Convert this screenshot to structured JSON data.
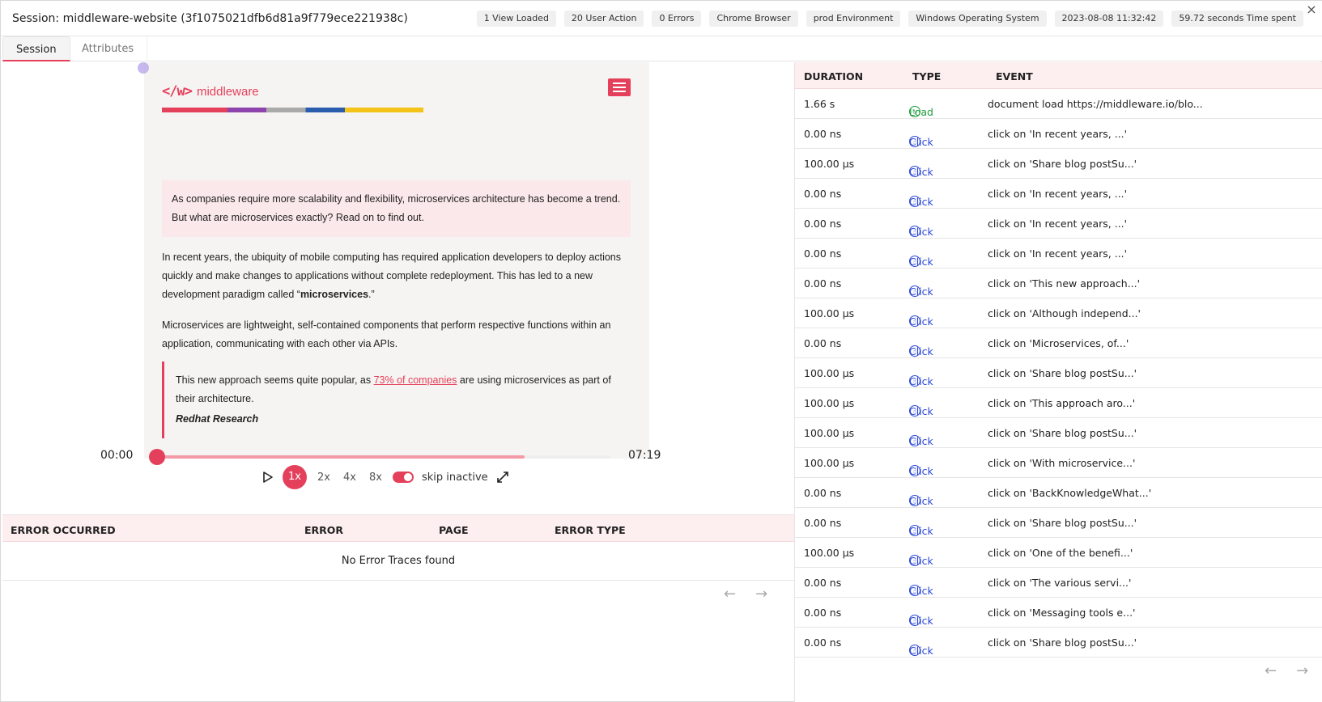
{
  "session": {
    "title": "Session: middleware-website (3f1075021dfb6d81a9f779ece221938c)",
    "chips": [
      "1 View Loaded",
      "20 User Action",
      "0 Errors",
      "Chrome Browser",
      "prod Environment",
      "Windows Operating System",
      "2023-08-08 11:32:42",
      "59.72 seconds Time spent"
    ],
    "close_icon": "×"
  },
  "tabs": [
    {
      "label": "Session",
      "active": true
    },
    {
      "label": "Attributes",
      "active": false
    }
  ],
  "replay": {
    "logo_text": "middleware",
    "callout": "As companies require more scalability and flexibility, microservices architecture has become a trend. But what are microservices exactly? Read on to find out.",
    "para1_before": "In recent years, the ubiquity of mobile computing has required application developers to deploy actions quickly and make changes to applications without complete redeployment. This has led to a new development paradigm called “",
    "para1_bold": "microservices",
    "para1_after": ".”",
    "para2": "Microservices are lightweight, self-contained components that perform respective functions within an application, communicating with each other via APIs.",
    "quote_before": "This new approach seems quite popular, as ",
    "quote_link": "73% of companies",
    "quote_after": " are using microservices as part of their architecture.",
    "quote_cite": "Redhat Research"
  },
  "player": {
    "time_start": "00:00",
    "time_end": "07:19",
    "progress": 0.81,
    "speeds": [
      "1x",
      "2x",
      "4x",
      "8x"
    ],
    "active_speed": "1x",
    "skip_label": "skip inactive",
    "skip_inactive": true
  },
  "errors": {
    "columns": [
      "ERROR OCCURRED",
      "ERROR",
      "PAGE",
      "ERROR TYPE"
    ],
    "empty_message": "No Error Traces found"
  },
  "events": {
    "columns": [
      "DURATION",
      "TYPE",
      "EVENT"
    ],
    "rows": [
      {
        "duration": "1.66 s",
        "type": "Load",
        "event": "document load https://middleware.io/blo..."
      },
      {
        "duration": "0.00 ns",
        "type": "Click",
        "event": "click on 'In recent years, ...'"
      },
      {
        "duration": "100.00 µs",
        "type": "Click",
        "event": "click on 'Share blog postSu...'"
      },
      {
        "duration": "0.00 ns",
        "type": "Click",
        "event": "click on 'In recent years, ...'"
      },
      {
        "duration": "0.00 ns",
        "type": "Click",
        "event": "click on 'In recent years, ...'"
      },
      {
        "duration": "0.00 ns",
        "type": "Click",
        "event": "click on 'In recent years, ...'"
      },
      {
        "duration": "0.00 ns",
        "type": "Click",
        "event": "click on 'This new approach...'"
      },
      {
        "duration": "100.00 µs",
        "type": "Click",
        "event": "click on 'Although independ...'"
      },
      {
        "duration": "0.00 ns",
        "type": "Click",
        "event": "click on 'Microservices, of...'"
      },
      {
        "duration": "100.00 µs",
        "type": "Click",
        "event": "click on 'Share blog postSu...'"
      },
      {
        "duration": "100.00 µs",
        "type": "Click",
        "event": "click on 'This approach aro...'"
      },
      {
        "duration": "100.00 µs",
        "type": "Click",
        "event": "click on 'Share blog postSu...'"
      },
      {
        "duration": "100.00 µs",
        "type": "Click",
        "event": "click on 'With microservice...'"
      },
      {
        "duration": "0.00 ns",
        "type": "Click",
        "event": "click on 'BackKnowledgeWhat...'"
      },
      {
        "duration": "0.00 ns",
        "type": "Click",
        "event": "click on 'Share blog postSu...'"
      },
      {
        "duration": "100.00 µs",
        "type": "Click",
        "event": "click on 'One of the benefi...'"
      },
      {
        "duration": "0.00 ns",
        "type": "Click",
        "event": "click on 'The various servi...'"
      },
      {
        "duration": "0.00 ns",
        "type": "Click",
        "event": "click on 'Messaging tools e...'"
      },
      {
        "duration": "0.00 ns",
        "type": "Click",
        "event": "click on 'Share blog postSu...'"
      }
    ]
  },
  "colors": {
    "accent": "#e5405b",
    "click": "#2c48d6",
    "load": "#1a9a3c",
    "header_row": "#fdeef0"
  },
  "icons": {
    "prev": "←",
    "next": "→"
  }
}
